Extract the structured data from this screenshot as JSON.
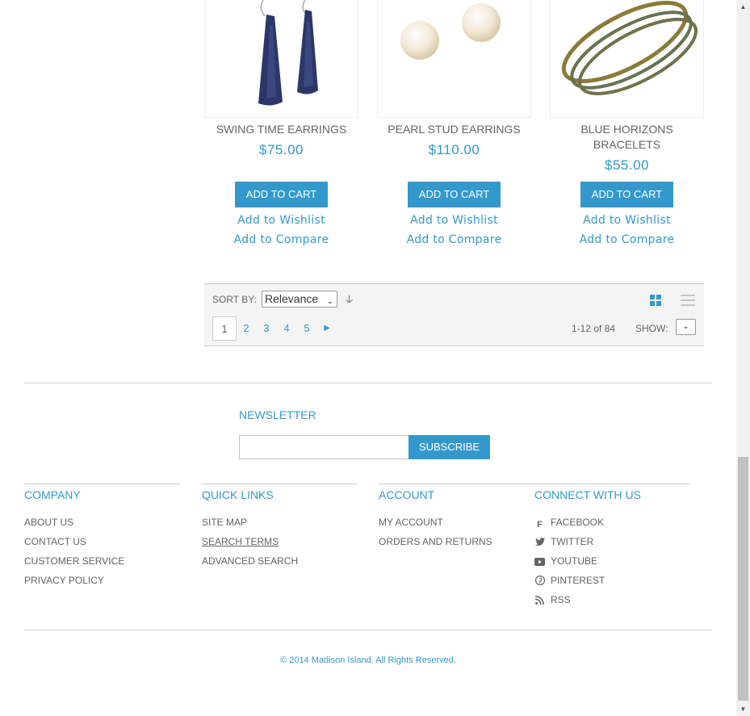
{
  "products": [
    {
      "name": "SWING TIME EARRINGS",
      "price": "$75.00",
      "cart_label": "ADD TO CART",
      "wishlist_label": "Add to Wishlist",
      "compare_label": "Add to Compare"
    },
    {
      "name": "PEARL STUD EARRINGS",
      "price": "$110.00",
      "cart_label": "ADD TO CART",
      "wishlist_label": "Add to Wishlist",
      "compare_label": "Add to Compare"
    },
    {
      "name": "BLUE HORIZONS BRACELETS",
      "price": "$55.00",
      "cart_label": "ADD TO CART",
      "wishlist_label": "Add to Wishlist",
      "compare_label": "Add to Compare"
    }
  ],
  "toolbar": {
    "sort_label": "SORT BY:",
    "sort_value": "Relevance",
    "pages": [
      "1",
      "2",
      "3",
      "4",
      "5"
    ],
    "current_page": "1",
    "next_icon": "next-arrow-icon",
    "amount": "1-12 of 84",
    "show_label": "SHOW:"
  },
  "newsletter": {
    "title": "NEWSLETTER",
    "input_value": "",
    "button_label": "SUBSCRIBE"
  },
  "footer": {
    "company": {
      "title": "COMPANY",
      "links": [
        "ABOUT US",
        "CONTACT US",
        "CUSTOMER SERVICE",
        "PRIVACY POLICY"
      ]
    },
    "quick_links": {
      "title": "QUICK LINKS",
      "links": [
        "SITE MAP",
        "SEARCH TERMS",
        "ADVANCED SEARCH"
      ]
    },
    "account": {
      "title": "ACCOUNT",
      "links": [
        "MY ACCOUNT",
        "ORDERS AND RETURNS"
      ]
    },
    "connect": {
      "title": "CONNECT WITH US",
      "links": [
        {
          "label": "FACEBOOK",
          "icon": "facebook-icon"
        },
        {
          "label": "TWITTER",
          "icon": "twitter-icon"
        },
        {
          "label": "YOUTUBE",
          "icon": "youtube-icon"
        },
        {
          "label": "PINTEREST",
          "icon": "pinterest-icon"
        },
        {
          "label": "RSS",
          "icon": "rss-icon"
        }
      ]
    },
    "copyright": "© 2014 Madison Island. All Rights Reserved."
  },
  "colors": {
    "accent": "#3399cc",
    "text": "#636363",
    "border": "#cccccc"
  }
}
